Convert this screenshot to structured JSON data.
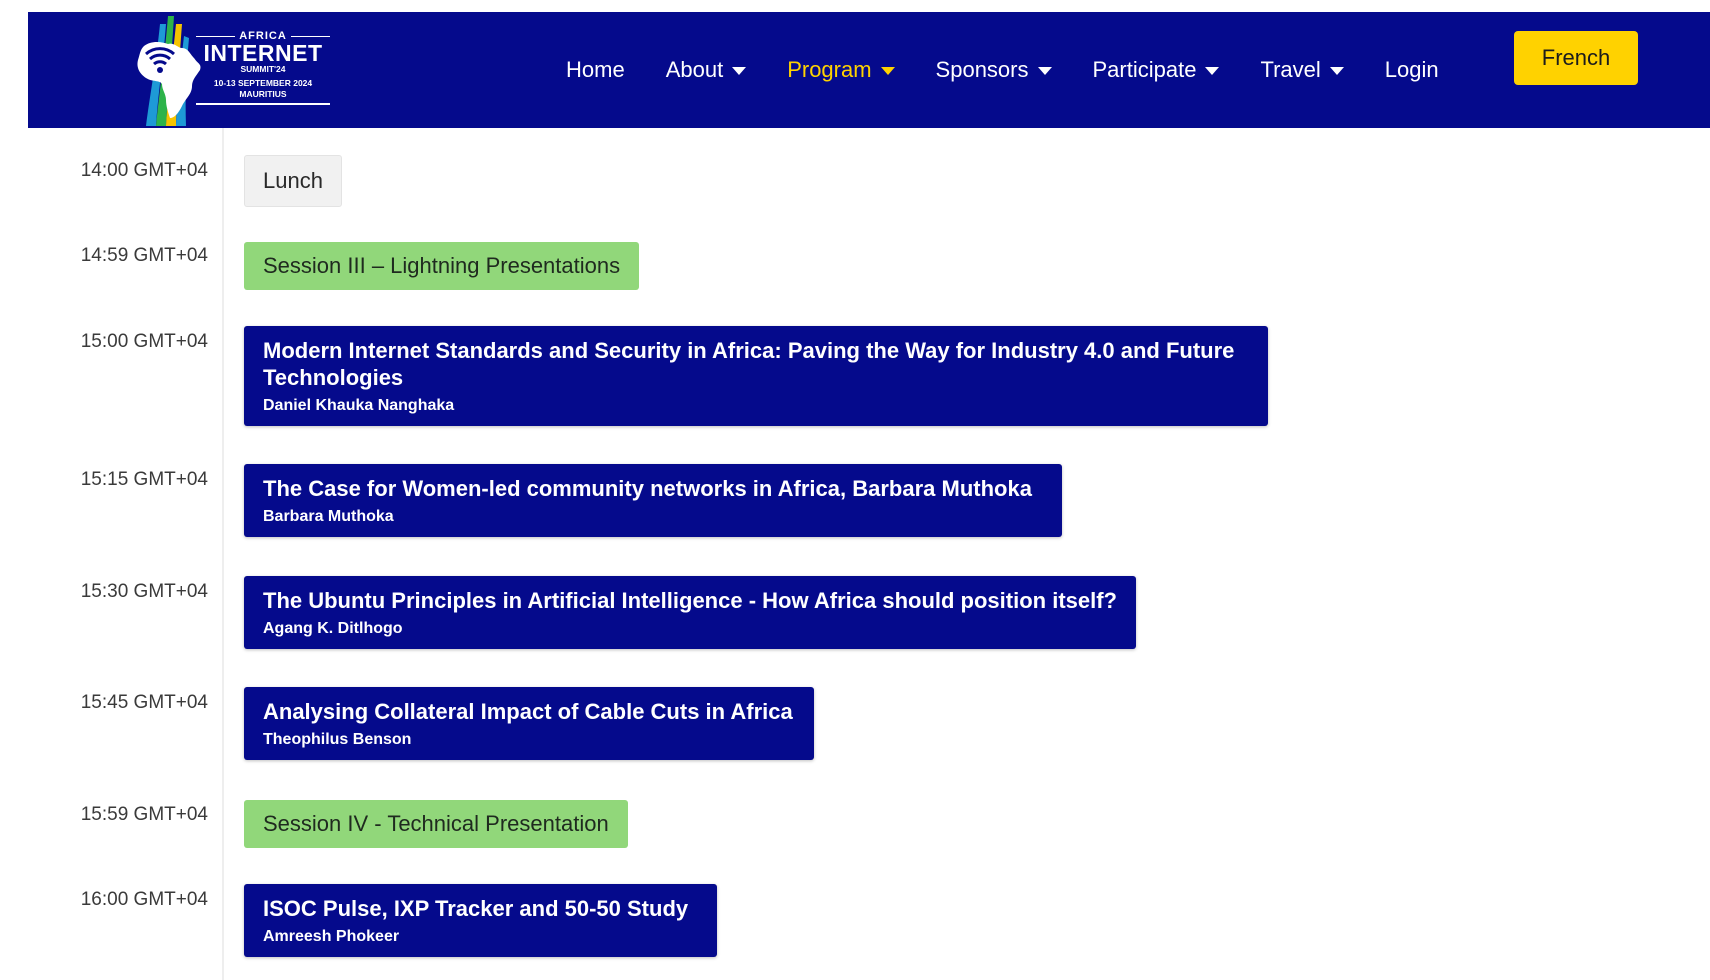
{
  "header": {
    "logo": {
      "top": "AFRICA",
      "name": "INTERNET",
      "subtitle": "SUMMIT'24",
      "dates": "10-13 SEPTEMBER 2024",
      "place": "MAURITIUS"
    },
    "nav": [
      {
        "label": "Home",
        "dropdown": false
      },
      {
        "label": "About",
        "dropdown": true
      },
      {
        "label": "Program",
        "dropdown": true,
        "active": true
      },
      {
        "label": "Sponsors",
        "dropdown": true
      },
      {
        "label": "Participate",
        "dropdown": true
      },
      {
        "label": "Travel",
        "dropdown": true
      },
      {
        "label": "Login",
        "dropdown": false
      }
    ],
    "language_button": "French"
  },
  "colors": {
    "navy": "#050a8c",
    "accent_yellow": "#ffd200",
    "session_green": "#91d77a",
    "break_gray": "#f1f1f1"
  },
  "schedule": [
    {
      "time": "14:00 GMT+04",
      "type": "break",
      "title": "Lunch"
    },
    {
      "time": "14:59 GMT+04",
      "type": "session",
      "title": "Session III – Lightning Presentations"
    },
    {
      "time": "15:00 GMT+04",
      "type": "talk",
      "title": "Modern Internet Standards and Security in Africa: Paving the Way for Industry 4.0 and Future Technologies",
      "speaker": "Daniel Khauka Nanghaka"
    },
    {
      "time": "15:15 GMT+04",
      "type": "talk",
      "title": "The Case for Women-led community networks in Africa, Barbara Muthoka",
      "speaker": "Barbara Muthoka"
    },
    {
      "time": "15:30 GMT+04",
      "type": "talk",
      "title": "The Ubuntu Principles in Artificial Intelligence - How Africa should position itself?",
      "speaker": "Agang K. Ditlhogo"
    },
    {
      "time": "15:45 GMT+04",
      "type": "talk",
      "title": "Analysing Collateral Impact of Cable Cuts in Africa",
      "speaker": "Theophilus Benson"
    },
    {
      "time": "15:59 GMT+04",
      "type": "session",
      "title": "Session IV - Technical Presentation"
    },
    {
      "time": "16:00 GMT+04",
      "type": "talk",
      "title": "ISOC Pulse, IXP Tracker and 50-50 Study",
      "speaker": "Amreesh Phokeer"
    }
  ]
}
